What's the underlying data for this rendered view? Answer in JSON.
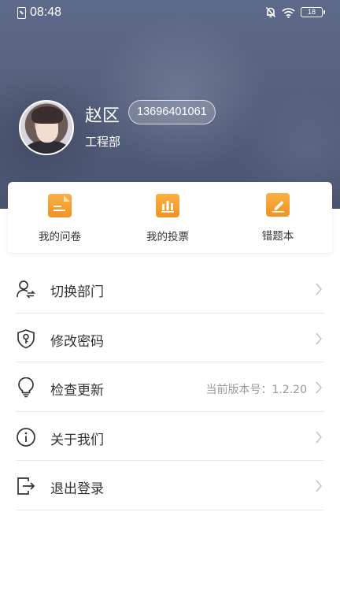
{
  "status_bar": {
    "time": "08:48",
    "battery": "18"
  },
  "profile": {
    "name": "赵区",
    "phone": "13696401061",
    "department": "工程部"
  },
  "quick_actions": [
    {
      "label": "我的问卷",
      "icon": "questionnaire-icon"
    },
    {
      "label": "我的投票",
      "icon": "vote-chart-icon"
    },
    {
      "label": "错题本",
      "icon": "edit-note-icon"
    }
  ],
  "menu": [
    {
      "label": "切换部门",
      "icon": "switch-user-icon",
      "value": ""
    },
    {
      "label": "修改密码",
      "icon": "shield-key-icon",
      "value": ""
    },
    {
      "label": "检查更新",
      "icon": "lightbulb-icon",
      "value": "当前版本号：1.2.20"
    },
    {
      "label": "关于我们",
      "icon": "info-icon",
      "value": ""
    },
    {
      "label": "退出登录",
      "icon": "logout-icon",
      "value": ""
    }
  ],
  "colors": {
    "accent_orange": "#f5a03a",
    "header_bg": "#56617e",
    "divider": "#e8e8e8"
  }
}
